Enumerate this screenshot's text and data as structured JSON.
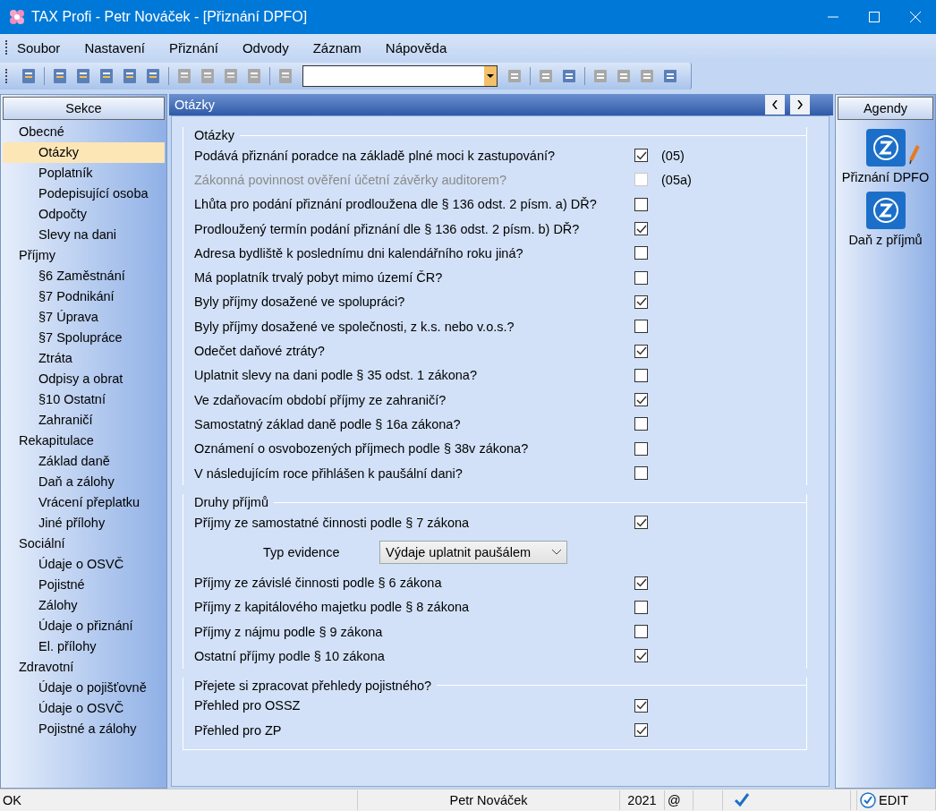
{
  "window": {
    "title": "TAX Profi - Petr Nováček - [Přiznání DPFO]"
  },
  "menu": [
    "Soubor",
    "Nastavení",
    "Přiznání",
    "Odvody",
    "Záznam",
    "Nápověda"
  ],
  "sidebar": {
    "title": "Sekce",
    "groups": [
      {
        "label": "Obecné",
        "children": [
          {
            "label": "Otázky",
            "selected": true
          },
          {
            "label": "Poplatník",
            "selected": false
          },
          {
            "label": "Podepisující osoba",
            "selected": false
          },
          {
            "label": "Odpočty",
            "selected": false
          },
          {
            "label": "Slevy na dani",
            "selected": false
          }
        ]
      },
      {
        "label": "Příjmy",
        "children": [
          {
            "label": "§6 Zaměstnání",
            "selected": false
          },
          {
            "label": "§7 Podnikání",
            "selected": false
          },
          {
            "label": "§7 Úprava",
            "selected": false
          },
          {
            "label": "§7 Spolupráce",
            "selected": false
          },
          {
            "label": "Ztráta",
            "selected": false
          },
          {
            "label": "Odpisy a obrat",
            "selected": false
          },
          {
            "label": "§10 Ostatní",
            "selected": false
          },
          {
            "label": "Zahraničí",
            "selected": false
          }
        ]
      },
      {
        "label": "Rekapitulace",
        "children": [
          {
            "label": "Základ daně",
            "selected": false
          },
          {
            "label": "Daň a zálohy",
            "selected": false
          },
          {
            "label": "Vrácení přeplatku",
            "selected": false
          },
          {
            "label": "Jiné přílohy",
            "selected": false
          }
        ]
      },
      {
        "label": "Sociální",
        "children": [
          {
            "label": "Údaje o OSVČ",
            "selected": false
          },
          {
            "label": "Pojistné",
            "selected": false
          },
          {
            "label": "Zálohy",
            "selected": false
          },
          {
            "label": "Údaje o přiznání",
            "selected": false
          },
          {
            "label": "El. přílohy",
            "selected": false
          }
        ]
      },
      {
        "label": "Zdravotní",
        "children": [
          {
            "label": "Údaje o pojišťovně",
            "selected": false
          },
          {
            "label": "Údaje o OSVČ",
            "selected": false
          },
          {
            "label": "Pojistné a zálohy",
            "selected": false
          }
        ]
      }
    ]
  },
  "panel": {
    "title": "Otázky",
    "sections": [
      {
        "title": "Otázky",
        "rows": [
          {
            "kind": "check",
            "label": "Podává přiznání poradce na základě plné moci k zastupování?",
            "checked": true,
            "disabled": false,
            "code": "(05)"
          },
          {
            "kind": "check",
            "label": "Zákonná povinnost ověření účetní závěrky auditorem?",
            "checked": false,
            "disabled": true,
            "code": "(05a)"
          },
          {
            "kind": "check",
            "label": "Lhůta pro podání přiznání prodloužena dle § 136 odst. 2 písm. a) DŘ?",
            "checked": false,
            "disabled": false
          },
          {
            "kind": "check",
            "label": "Prodloužený termín podání přiznání dle § 136 odst. 2 písm. b) DŘ?",
            "checked": true,
            "disabled": false
          },
          {
            "kind": "check",
            "label": "Adresa bydliště k poslednímu dni kalendářního roku jiná?",
            "checked": false,
            "disabled": false
          },
          {
            "kind": "check",
            "label": "Má poplatník trvalý pobyt mimo území ČR?",
            "checked": false,
            "disabled": false
          },
          {
            "kind": "check",
            "label": "Byly příjmy dosažené ve spolupráci?",
            "checked": true,
            "disabled": false
          },
          {
            "kind": "check",
            "label": "Byly příjmy dosažené ve společnosti, z k.s. nebo v.o.s.?",
            "checked": false,
            "disabled": false
          },
          {
            "kind": "check",
            "label": "Odečet daňové ztráty?",
            "checked": true,
            "disabled": false
          },
          {
            "kind": "check",
            "label": "Uplatnit slevy na dani podle § 35 odst. 1 zákona?",
            "checked": false,
            "disabled": false
          },
          {
            "kind": "check",
            "label": "Ve zdaňovacím období příjmy ze zahraničí?",
            "checked": true,
            "disabled": false
          },
          {
            "kind": "check",
            "label": "Samostatný základ daně podle § 16a zákona?",
            "checked": false,
            "disabled": false
          },
          {
            "kind": "check",
            "label": "Oznámení o osvobozených příjmech podle § 38v zákona?",
            "checked": false,
            "disabled": false
          },
          {
            "kind": "check",
            "label": "V následujícím roce přihlášen k paušální dani?",
            "checked": false,
            "disabled": false
          }
        ]
      },
      {
        "title": "Druhy příjmů",
        "rows": [
          {
            "kind": "check",
            "label": "Příjmy ze samostatné činnosti podle § 7 zákona",
            "checked": true,
            "disabled": false
          },
          {
            "kind": "select",
            "label": "Typ evidence",
            "value": "Výdaje uplatnit paušálem"
          },
          {
            "kind": "check",
            "label": "Příjmy ze závislé činnosti podle § 6 zákona",
            "checked": true,
            "disabled": false
          },
          {
            "kind": "check",
            "label": "Příjmy z kapitálového majetku podle § 8 zákona",
            "checked": false,
            "disabled": false
          },
          {
            "kind": "check",
            "label": "Příjmy z nájmu podle § 9 zákona",
            "checked": false,
            "disabled": false
          },
          {
            "kind": "check",
            "label": "Ostatní příjmy podle § 10 zákona",
            "checked": true,
            "disabled": false
          }
        ]
      },
      {
        "title": "Přejete si zpracovat přehledy pojistného?",
        "rows": [
          {
            "kind": "check",
            "label": "Přehled pro OSSZ",
            "checked": true,
            "disabled": false
          },
          {
            "kind": "check",
            "label": "Přehled pro ZP",
            "checked": true,
            "disabled": false
          }
        ]
      }
    ]
  },
  "agendy": {
    "title": "Agendy",
    "items": [
      {
        "label": "Přiznání DPFO",
        "editing": true
      },
      {
        "label": "Daň z příjmů",
        "editing": false
      }
    ]
  },
  "status_bar": {
    "message": "OK",
    "user": "Petr Nováček",
    "year": "2021",
    "mail": "@",
    "mode": "EDIT"
  }
}
